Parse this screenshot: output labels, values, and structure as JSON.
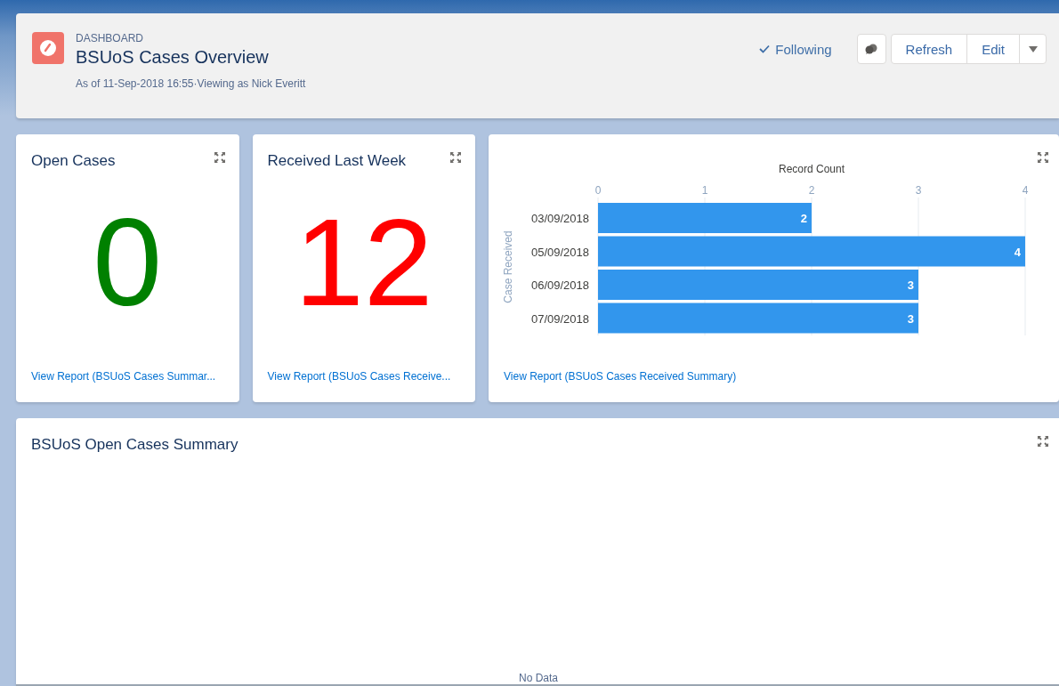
{
  "header": {
    "eyebrow": "DASHBOARD",
    "title": "BSUoS Cases Overview",
    "subtitle": "As of 11-Sep-2018 16:55·Viewing as Nick Everitt",
    "follow": {
      "label": "Following",
      "checked": true
    },
    "buttons": [
      "Refresh",
      "Edit"
    ]
  },
  "metrics": [
    {
      "title": "Open Cases",
      "value": "0",
      "color": "#008000",
      "link": "View Report (BSUoS Cases Summar..."
    },
    {
      "title": "Received Last Week",
      "value": "12",
      "color": "#ff0000",
      "link": "View Report (BSUoS Cases Receive..."
    }
  ],
  "chart_card": {
    "link": "View Report (BSUoS Cases Received Summary)",
    "chart_data": {
      "type": "bar",
      "orientation": "horizontal",
      "xlabel": "Record Count",
      "ylabel": "Case Received",
      "categories": [
        "03/09/2018",
        "05/09/2018",
        "06/09/2018",
        "07/09/2018"
      ],
      "values": [
        2,
        4,
        3,
        3
      ],
      "xlim": [
        0,
        4
      ],
      "xticks": [
        0,
        1,
        2,
        3,
        4
      ],
      "data_labels": true,
      "grid": true
    }
  },
  "summary": {
    "title": "BSUoS Open Cases Summary",
    "empty_text": "No Data"
  }
}
